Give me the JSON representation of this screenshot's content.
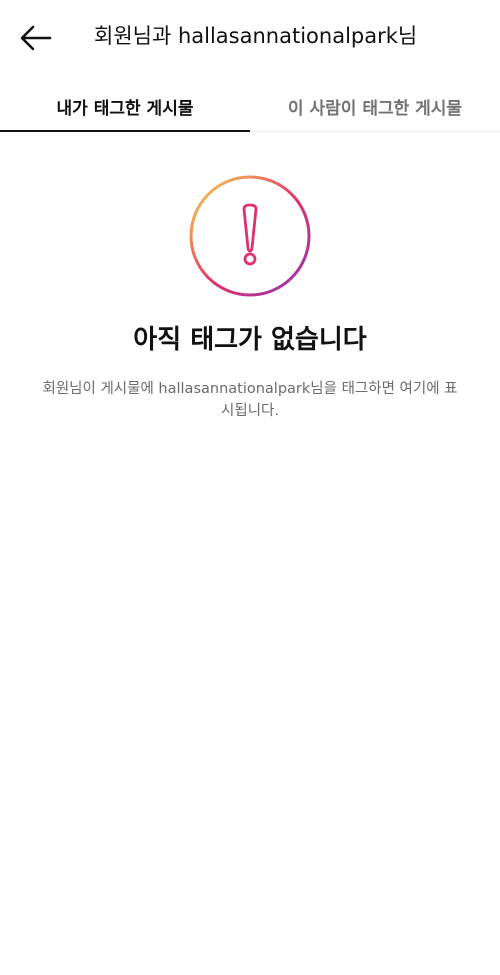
{
  "header": {
    "title": "회원님과 hallasannationalpark님",
    "back_icon": "arrow-left-icon"
  },
  "tabs": [
    {
      "label": "내가 태그한 게시물",
      "active": true
    },
    {
      "label": "이 사람이 태그한 게시물",
      "active": false
    }
  ],
  "empty_state": {
    "icon": "exclamation-circle-icon",
    "title": "아직 태그가 없습니다",
    "description": "회원님이 게시물에 hallasannationalpark님을 태그하면 여기에 표시됩니다."
  },
  "colors": {
    "active_text": "#111111",
    "inactive_text": "#737373",
    "gradient_start": "#f9d84a",
    "gradient_mid": "#e1306c",
    "gradient_end": "#8a3ab9"
  }
}
